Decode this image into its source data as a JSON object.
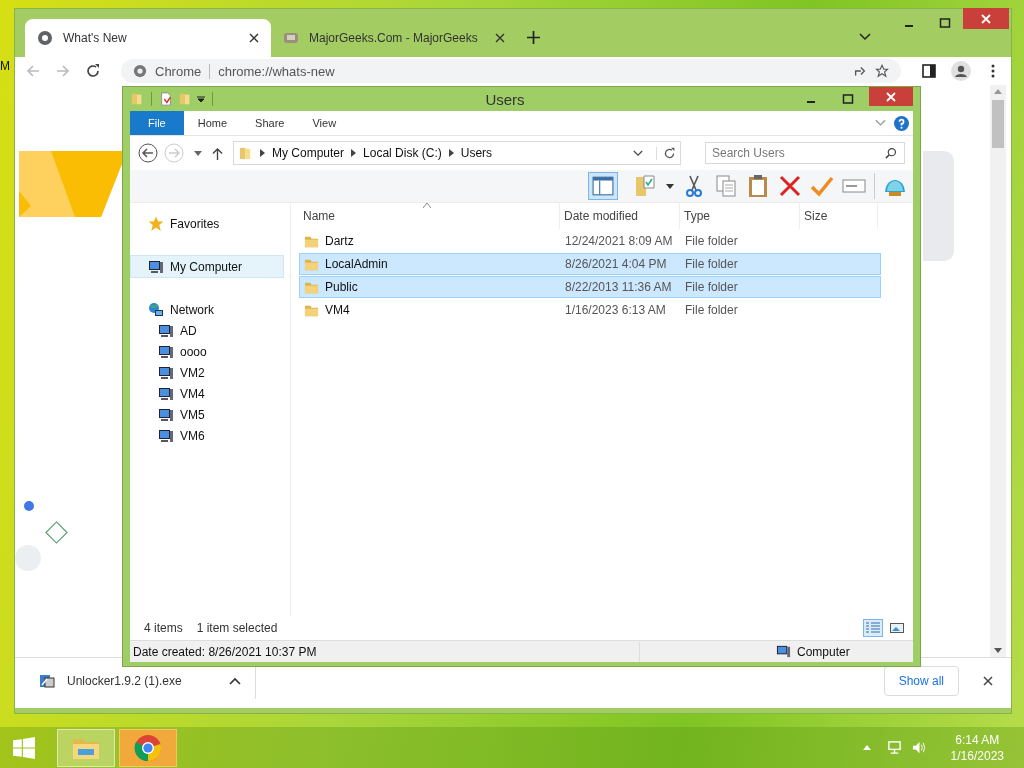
{
  "desktop": {
    "corner_label": "M"
  },
  "chrome": {
    "tabs": [
      {
        "title": "What's New",
        "selected": true
      },
      {
        "title": "MajorGeeks.Com - MajorGeeks",
        "selected": false
      }
    ],
    "address": {
      "site_label": "Chrome",
      "url": "chrome://whats-new"
    },
    "download": {
      "file": "Unlocker1.9.2 (1).exe",
      "show_all": "Show all"
    }
  },
  "explorer": {
    "title": "Users",
    "ribbon_tabs": [
      {
        "label": "File",
        "selected": true
      },
      {
        "label": "Home",
        "selected": false
      },
      {
        "label": "Share",
        "selected": false
      },
      {
        "label": "View",
        "selected": false
      }
    ],
    "breadcrumb": [
      "My Computer",
      "Local Disk (C:)",
      "Users"
    ],
    "search": {
      "placeholder": "Search Users"
    },
    "nav": [
      {
        "label": "Favorites",
        "kind": "favorites",
        "selected": false
      },
      {
        "label": "My Computer",
        "kind": "computer",
        "selected": true
      },
      {
        "label": "Network",
        "kind": "network",
        "selected": false,
        "children": [
          {
            "label": "AD",
            "kind": "computer",
            "selected": false
          },
          {
            "label": "oooo",
            "kind": "computer",
            "selected": false
          },
          {
            "label": "VM2",
            "kind": "computer",
            "selected": false
          },
          {
            "label": "VM4",
            "kind": "computer",
            "selected": false
          },
          {
            "label": "VM5",
            "kind": "computer",
            "selected": false
          },
          {
            "label": "VM6",
            "kind": "computer",
            "selected": false
          }
        ]
      }
    ],
    "columns": [
      "Name",
      "Date modified",
      "Type",
      "Size"
    ],
    "rows": [
      {
        "name": "Dartz",
        "date": "12/24/2021 8:09 AM",
        "type": "File folder",
        "selected": false
      },
      {
        "name": "LocalAdmin",
        "date": "8/26/2021 4:04 PM",
        "type": "File folder",
        "selected": true
      },
      {
        "name": "Public",
        "date": "8/22/2013 11:36 AM",
        "type": "File folder",
        "selected": true
      },
      {
        "name": "VM4",
        "date": "1/16/2023 6:13 AM",
        "type": "File folder",
        "selected": false
      }
    ],
    "item_count": "4 items",
    "selection": "1 item selected",
    "views": [
      {
        "kind": "details",
        "selected": true
      },
      {
        "kind": "tiles",
        "selected": false
      }
    ],
    "status": {
      "detail": "Date created: 8/26/2021 10:37 PM",
      "location": "Computer"
    }
  },
  "taskbar": {
    "apps": [
      {
        "kind": "explorer"
      },
      {
        "kind": "chrome"
      }
    ],
    "time": "6:14 AM",
    "date": "1/16/2023"
  }
}
